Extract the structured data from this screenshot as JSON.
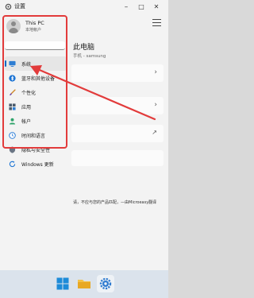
{
  "window": {
    "title": "设置",
    "minimize": "–",
    "maximize": "□",
    "close": "✕"
  },
  "profile": {
    "name": "This PC",
    "account_type": "本地帐户"
  },
  "nav": [
    {
      "label": "系统",
      "icon": "monitor-icon",
      "active": true
    },
    {
      "label": "蓝牙和其他设备",
      "icon": "bluetooth-icon",
      "active": false
    },
    {
      "label": "个性化",
      "icon": "brush-icon",
      "active": false
    },
    {
      "label": "应用",
      "icon": "apps-icon",
      "active": false
    },
    {
      "label": "帐户",
      "icon": "account-icon",
      "active": false
    },
    {
      "label": "时间和语言",
      "icon": "clock-globe-icon",
      "active": false
    },
    {
      "label": "隐私与安全性",
      "icon": "shield-icon",
      "active": false
    },
    {
      "label": "Windows 更新",
      "icon": "update-icon",
      "active": false
    }
  ],
  "main": {
    "title": "此电脑",
    "subtitle": "手机 - samsung",
    "card_arrow": "›",
    "external_arrow": "↗",
    "notice": "请，不应与您的产品匹配，—由Microeasy翻译"
  },
  "colors": {
    "accent": "#0067c0",
    "annotation": "#e23b3b"
  }
}
